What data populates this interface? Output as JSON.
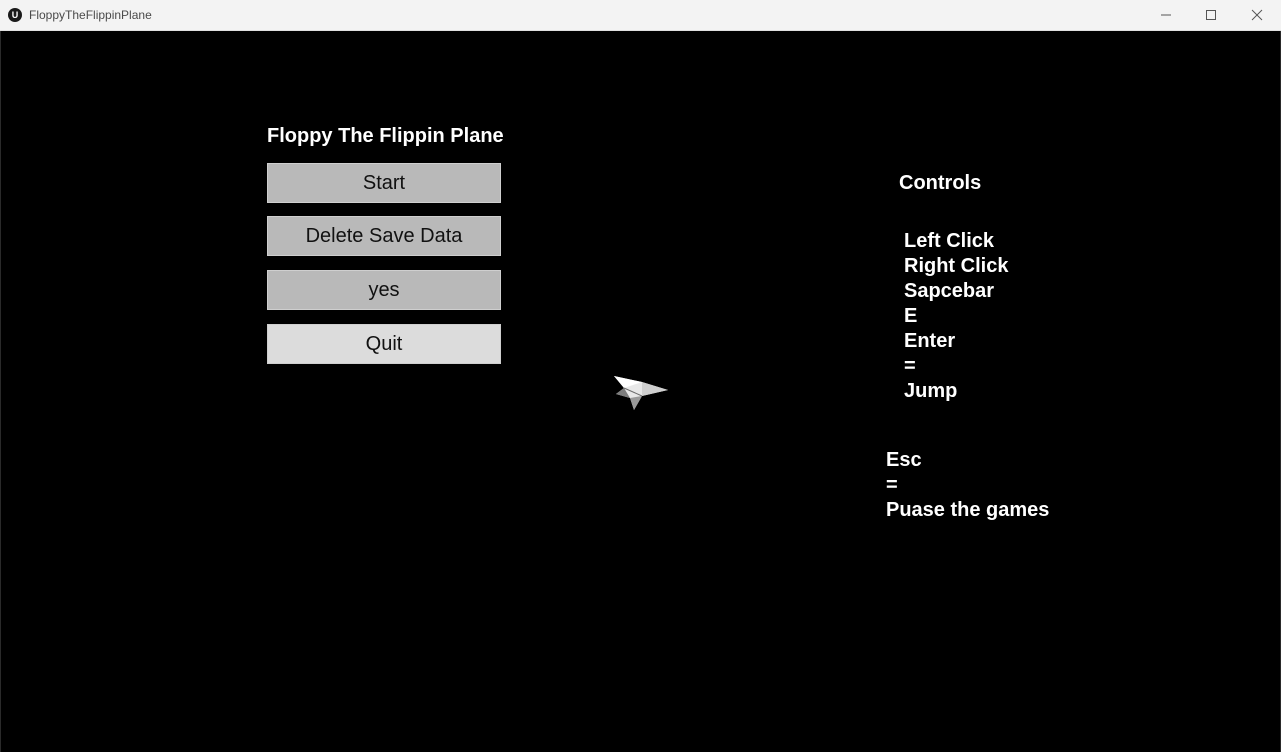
{
  "window": {
    "title": "FloppyTheFlippinPlane",
    "icon": "unreal-engine-icon",
    "buttons": [
      "minimize-icon",
      "maximize-icon",
      "close-icon"
    ]
  },
  "menu": {
    "title": "Floppy The Flippin Plane",
    "start_label": "Start",
    "delete_label": "Delete Save Data",
    "yes_label": "yes",
    "quit_label": "Quit"
  },
  "controls": {
    "title": "Controls",
    "lines": [
      "Left Click",
      "Right Click",
      "Sapcebar",
      "E",
      "Enter",
      "=",
      "Jump"
    ],
    "esc_lines": [
      "Esc",
      "=",
      "Puase the games"
    ]
  },
  "colors": {
    "background": "#000000",
    "button": "#b9b9b9",
    "button_hover": "#dcdcdc",
    "text": "#ffffff"
  }
}
